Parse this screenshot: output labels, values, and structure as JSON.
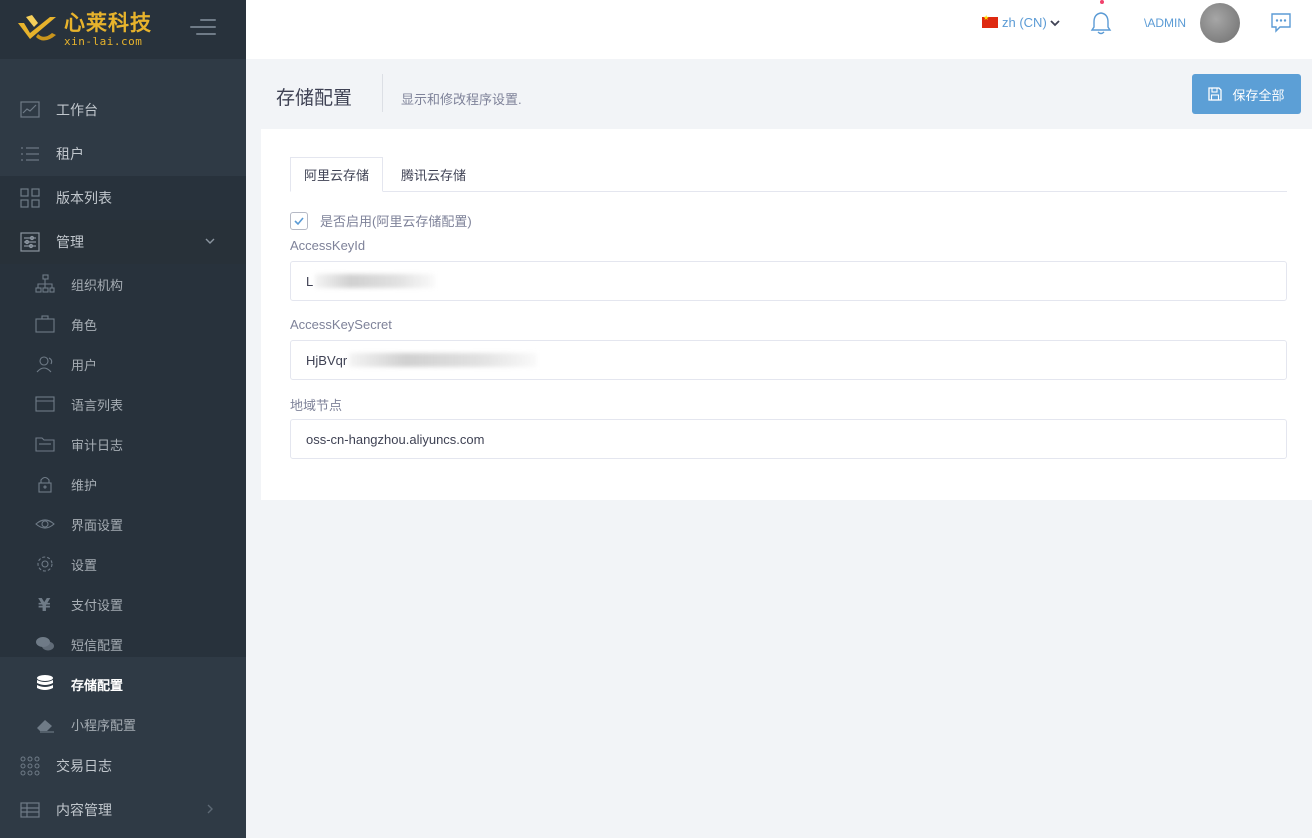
{
  "brand": {
    "name_cn": "心莱科技",
    "domain": "xin-lai.com"
  },
  "header": {
    "language": "zh (CN)",
    "user": "\\ADMIN"
  },
  "sidebar": {
    "items": [
      {
        "label": "工作台",
        "icon": "chart-line-icon"
      },
      {
        "label": "租户",
        "icon": "list-icon"
      },
      {
        "label": "版本列表",
        "icon": "grid-icon"
      },
      {
        "label": "管理",
        "icon": "sliders-icon"
      },
      {
        "label": "交易日志",
        "icon": "dots-grid-icon"
      },
      {
        "label": "内容管理",
        "icon": "table-icon"
      }
    ],
    "sub_items": [
      {
        "label": "组织机构",
        "icon": "sitemap-icon"
      },
      {
        "label": "角色",
        "icon": "briefcase-icon"
      },
      {
        "label": "用户",
        "icon": "users-icon"
      },
      {
        "label": "语言列表",
        "icon": "window-icon"
      },
      {
        "label": "审计日志",
        "icon": "folder-icon"
      },
      {
        "label": "维护",
        "icon": "lock-icon"
      },
      {
        "label": "界面设置",
        "icon": "eye-icon"
      },
      {
        "label": "设置",
        "icon": "gear-icon"
      },
      {
        "label": "支付设置",
        "icon": "yen-icon"
      },
      {
        "label": "短信配置",
        "icon": "comments-icon"
      },
      {
        "label": "存储配置",
        "icon": "database-icon"
      },
      {
        "label": "小程序配置",
        "icon": "eraser-icon"
      }
    ]
  },
  "page": {
    "title": "存储配置",
    "description": "显示和修改程序设置.",
    "save_label": "保存全部"
  },
  "tabs": [
    "阿里云存储",
    "腾讯云存储"
  ],
  "form": {
    "enable_label": "是否启用(阿里云存储配置)",
    "enabled": true,
    "access_key_id_label": "AccessKeyId",
    "access_key_id_value": "L",
    "access_key_secret_label": "AccessKeySecret",
    "access_key_secret_value": "HjBVqr",
    "region_label": "地域节点",
    "region_value": "oss-cn-hangzhou.aliyuncs.com"
  }
}
